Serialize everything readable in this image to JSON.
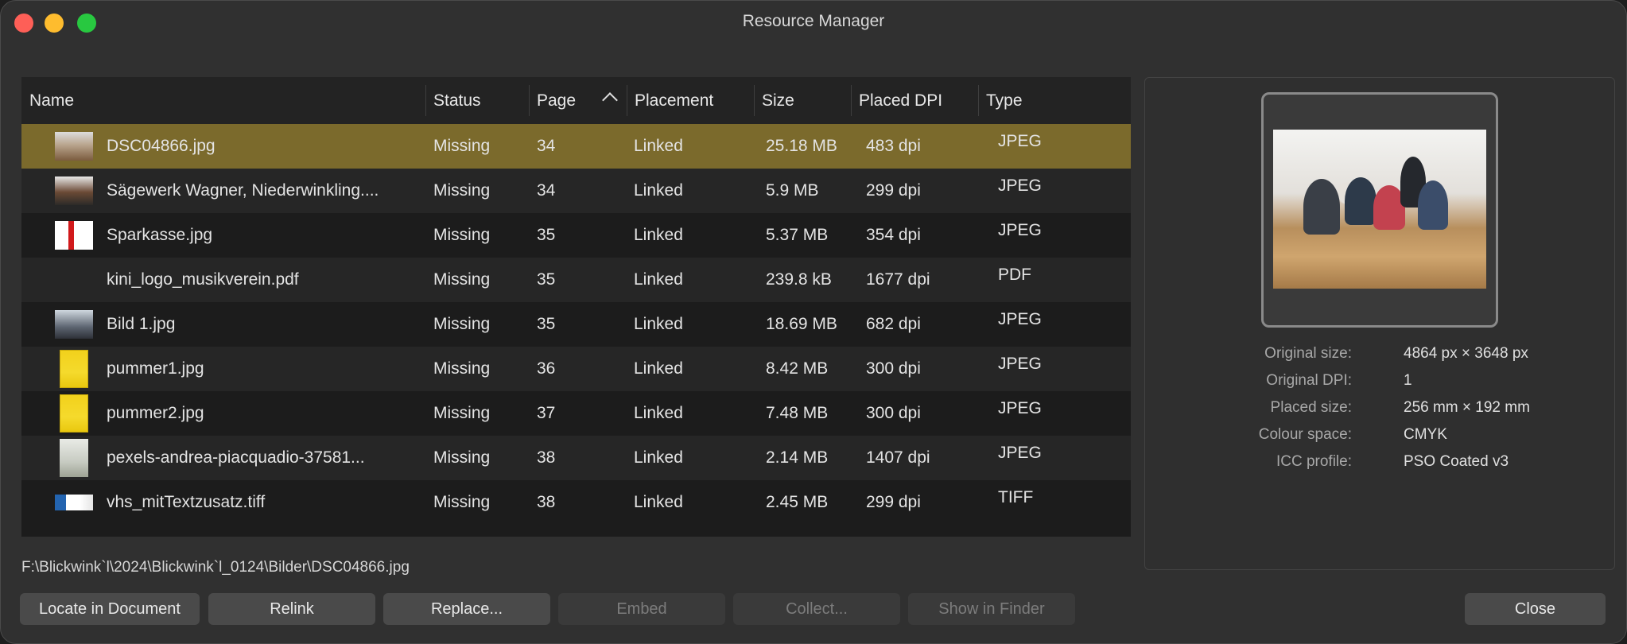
{
  "window": {
    "title": "Resource Manager"
  },
  "table": {
    "columns": [
      {
        "label": "Name"
      },
      {
        "label": "Status"
      },
      {
        "label": "Page"
      },
      {
        "label": "Placement"
      },
      {
        "label": "Size"
      },
      {
        "label": "Placed DPI"
      },
      {
        "label": "Type"
      }
    ],
    "sorted_column": "Page",
    "sort_direction": "ascending",
    "rows": [
      {
        "name": "DSC04866.jpg",
        "status": "Missing",
        "page": "34",
        "placement": "Linked",
        "size": "25.18 MB",
        "dpi": "483 dpi",
        "type": "JPEG",
        "thumb": "t-photo",
        "selected": true
      },
      {
        "name": "Sägewerk Wagner, Niederwinkling....",
        "status": "Missing",
        "page": "34",
        "placement": "Linked",
        "size": "5.9 MB",
        "dpi": "299 dpi",
        "type": "JPEG",
        "thumb": "t-mill"
      },
      {
        "name": "Sparkasse.jpg",
        "status": "Missing",
        "page": "35",
        "placement": "Linked",
        "size": "5.37 MB",
        "dpi": "354 dpi",
        "type": "JPEG",
        "thumb": "t-spark"
      },
      {
        "name": "kini_logo_musikverein.pdf",
        "status": "Missing",
        "page": "35",
        "placement": "Linked",
        "size": "239.8 kB",
        "dpi": "1677 dpi",
        "type": "PDF",
        "thumb": "t-logo"
      },
      {
        "name": "Bild 1.jpg",
        "status": "Missing",
        "page": "35",
        "placement": "Linked",
        "size": "18.69 MB",
        "dpi": "682 dpi",
        "type": "JPEG",
        "thumb": "t-group"
      },
      {
        "name": "pummer1.jpg",
        "status": "Missing",
        "page": "36",
        "placement": "Linked",
        "size": "8.42 MB",
        "dpi": "300 dpi",
        "type": "JPEG",
        "thumb": "t-poster"
      },
      {
        "name": "pummer2.jpg",
        "status": "Missing",
        "page": "37",
        "placement": "Linked",
        "size": "7.48 MB",
        "dpi": "300 dpi",
        "type": "JPEG",
        "thumb": "t-poster"
      },
      {
        "name": "pexels-andrea-piacquadio-37581...",
        "status": "Missing",
        "page": "38",
        "placement": "Linked",
        "size": "2.14 MB",
        "dpi": "1407 dpi",
        "type": "JPEG",
        "thumb": "t-tall"
      },
      {
        "name": "vhs_mitTextzusatz.tiff",
        "status": "Missing",
        "page": "38",
        "placement": "Linked",
        "size": "2.45 MB",
        "dpi": "299 dpi",
        "type": "TIFF",
        "thumb": "t-vhs"
      }
    ]
  },
  "path": "F:\\Blickwink`l\\2024\\Blickwink`l_0124\\Bilder\\DSC04866.jpg",
  "preview": {
    "properties": [
      {
        "label": "Original size:",
        "value": "4864 px × 3648 px"
      },
      {
        "label": "Original DPI:",
        "value": "1"
      },
      {
        "label": "Placed size:",
        "value": "256 mm × 192 mm"
      },
      {
        "label": "Colour space:",
        "value": "CMYK"
      },
      {
        "label": "ICC profile:",
        "value": "PSO Coated v3"
      }
    ]
  },
  "buttons": {
    "locate": "Locate in Document",
    "relink": "Relink",
    "replace": "Replace...",
    "embed": "Embed",
    "collect": "Collect...",
    "show_in_finder": "Show in Finder",
    "close": "Close"
  },
  "icons": {
    "close_window": "red-close-icon",
    "minimize_window": "yellow-minimize-icon",
    "zoom_window": "green-zoom-icon",
    "sort": "chevron-up-icon"
  },
  "colors": {
    "selected_row": "#7b6a2c",
    "traffic_red": "#fe5f57",
    "traffic_yellow": "#febc2e",
    "traffic_green": "#28c840"
  }
}
